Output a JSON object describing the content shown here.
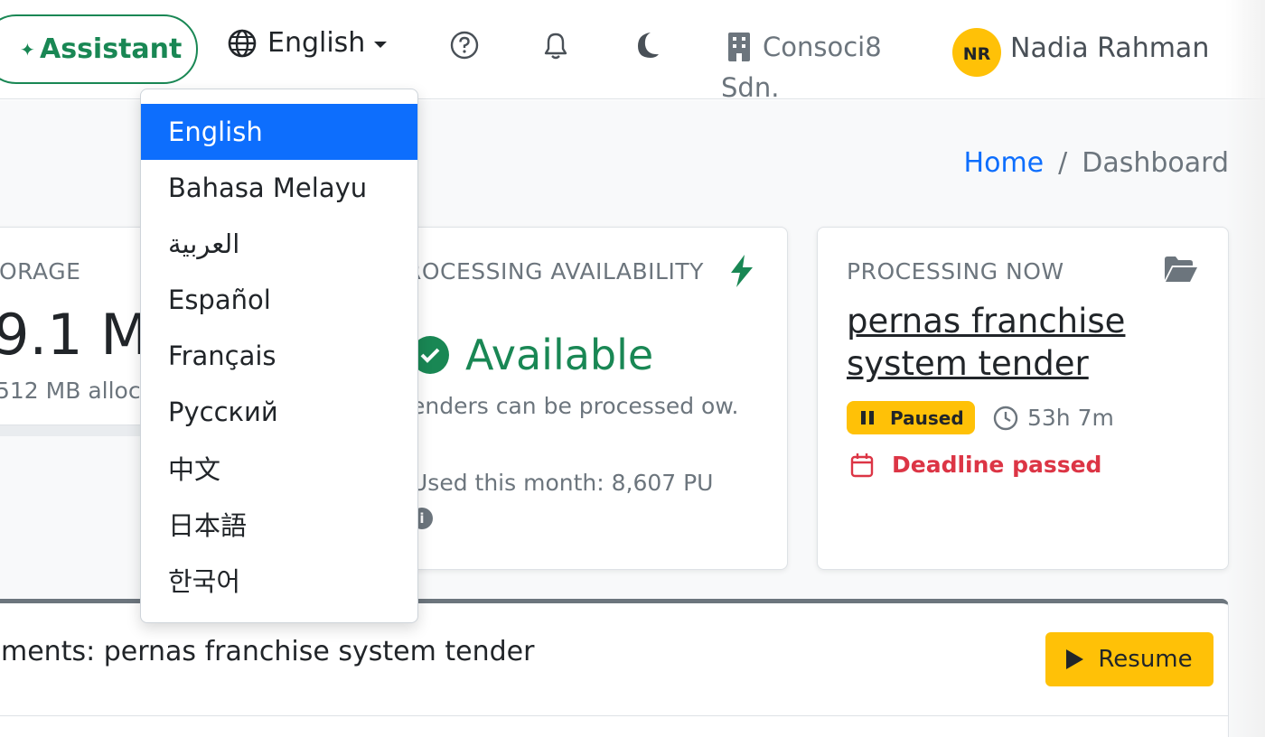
{
  "header": {
    "assistant_label": "Assistant",
    "language_label": "English",
    "company_line1": "Consoci8",
    "company_line2": "Sdn.",
    "user_initials": "NR",
    "user_name": "Nadia Rahman"
  },
  "language_menu": {
    "items": [
      "English",
      "Bahasa Melayu",
      "العربية",
      "Español",
      "Français",
      "Русский",
      "中文",
      "日本語",
      "한국어"
    ],
    "selected": "English"
  },
  "breadcrumb": {
    "home": "Home",
    "separator": "/",
    "current": "Dashboard"
  },
  "storage_card": {
    "label": "ORAGE",
    "value": "9.1 M",
    "sub": "512 MB alloc"
  },
  "processing_card": {
    "title": "ROCESSING AVAILABILITY",
    "status": "Available",
    "description": "enders can be processed ow.",
    "used": "Used this month: 8,607 PU"
  },
  "now_card": {
    "title": "PROCESSING NOW",
    "tender": "pernas franchise system tender",
    "badge": "Paused",
    "elapsed": "53h 7m",
    "deadline": "Deadline passed"
  },
  "documents": {
    "title": "ments: pernas franchise system tender",
    "resume_label": "Resume"
  },
  "colors": {
    "primary": "#0d6efd",
    "success": "#198754",
    "warning": "#ffc107",
    "danger": "#dc3545",
    "muted": "#6c757d"
  }
}
